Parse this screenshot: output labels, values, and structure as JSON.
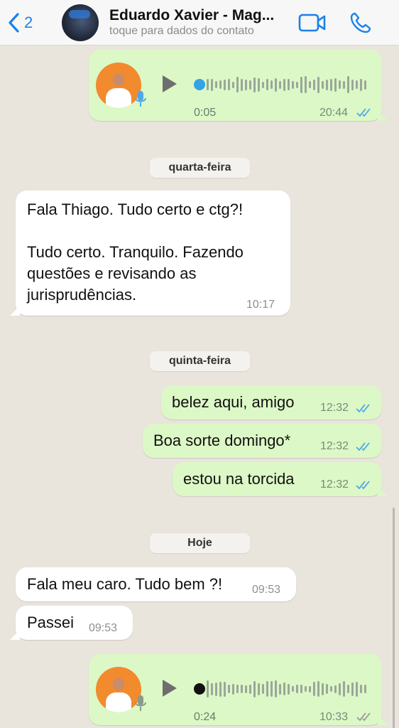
{
  "header": {
    "back_count": "2",
    "contact_name": "Eduardo Xavier - Mag...",
    "contact_subtitle": "toque para dados do contato"
  },
  "messages": [
    {
      "type": "audio",
      "direction": "out",
      "duration": "0:05",
      "time": "20:44",
      "progress": 0.0
    },
    {
      "type": "day",
      "label": "quarta-feira"
    },
    {
      "type": "text",
      "direction": "in",
      "text": "Fala Thiago. Tudo certo e ctg?!\n\nTudo certo. Tranquilo. Fazendo\nquestões e revisando as\njurisprudências.",
      "time": "10:17"
    },
    {
      "type": "day",
      "label": "quinta-feira"
    },
    {
      "type": "text",
      "direction": "out",
      "text": "belez aqui, amigo",
      "time": "12:32"
    },
    {
      "type": "text",
      "direction": "out",
      "text": "Boa sorte domingo*",
      "time": "12:32"
    },
    {
      "type": "text",
      "direction": "out",
      "text": "estou na torcida",
      "time": "12:32"
    },
    {
      "type": "day",
      "label": "Hoje"
    },
    {
      "type": "text",
      "direction": "in",
      "text": "Fala meu caro. Tudo bem ?!",
      "time": "09:53"
    },
    {
      "type": "text",
      "direction": "in",
      "text": "Passei",
      "time": "09:53"
    },
    {
      "type": "audio",
      "direction": "out",
      "duration": "0:24",
      "time": "10:33",
      "progress": 0.0
    }
  ],
  "colors": {
    "accent": "#1a82e8",
    "outgoing_bubble": "#dcf8c6",
    "incoming_bubble": "#ffffff",
    "read_ticks": "#4fa8e8",
    "unread_ticks": "#9a9a9a"
  }
}
